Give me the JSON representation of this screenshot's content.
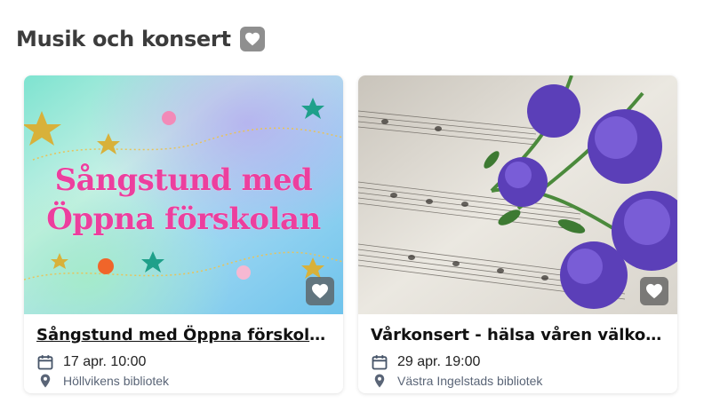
{
  "section": {
    "title": "Musik och konsert",
    "header_icon": "heart-icon"
  },
  "colors": {
    "title": "#3c3c3c",
    "place": "#5a6577",
    "accent_pink": "#ec3f9e",
    "icon_slate": "#475569"
  },
  "cards": [
    {
      "title": "Sångstund med Öppna förskolan",
      "image_text_line1": "Sångstund med",
      "image_text_line2": "Öppna förskolan",
      "date": "17 apr. 10:00",
      "place": "Höllvikens bibliotek",
      "date_icon": "calendar-icon",
      "place_icon": "map-pin-icon",
      "favorite_icon": "heart-icon"
    },
    {
      "title": "Vårkonsert - hälsa våren välkom...",
      "date": "29 apr. 19:00",
      "place": "Västra Ingelstads bibliotek",
      "date_icon": "calendar-icon",
      "place_icon": "map-pin-icon",
      "favorite_icon": "heart-icon"
    }
  ]
}
